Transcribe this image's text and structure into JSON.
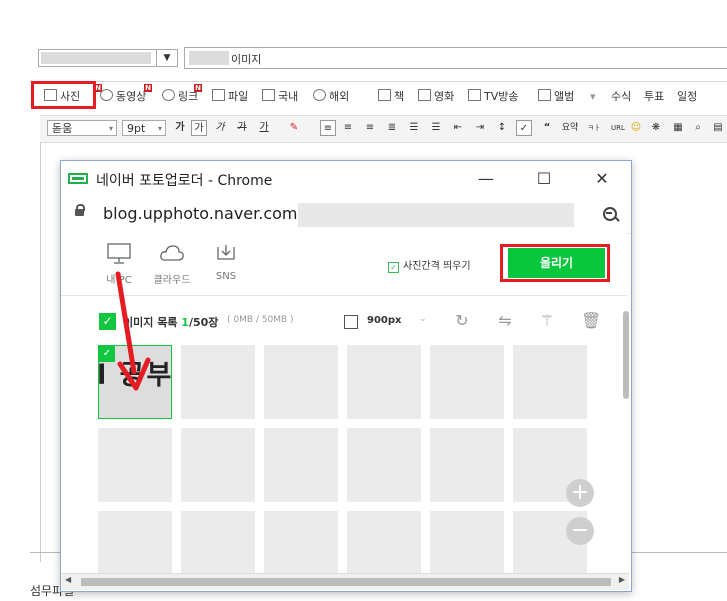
{
  "editor": {
    "title_suffix": "이미지",
    "toolbar1": [
      {
        "label": "사진",
        "badge": "N"
      },
      {
        "label": "동영상",
        "badge": "N"
      },
      {
        "label": "링크",
        "badge": "N"
      },
      {
        "label": "파일"
      },
      {
        "label": "국내"
      },
      {
        "label": "해외"
      },
      {
        "label": "책"
      },
      {
        "label": "영화"
      },
      {
        "label": "TV방송"
      },
      {
        "label": "앨범"
      },
      {
        "label": "수식"
      },
      {
        "label": "투표"
      },
      {
        "label": "일정"
      }
    ],
    "font_family": "돋움",
    "font_size": "9pt",
    "format_buttons": [
      "가",
      "가",
      "가",
      "가",
      "가"
    ],
    "quote_label": "요약",
    "url_label": "URL",
    "footer_text": "섬무파일"
  },
  "popup": {
    "window_title": "네이버 포토업로더 - Chrome",
    "address_text": "blog.upphoto.naver.com",
    "sources": [
      {
        "label": "내 PC",
        "icon": "monitor-icon"
      },
      {
        "label": "클라우드",
        "icon": "cloud-icon"
      },
      {
        "label": "SNS",
        "icon": "share-icon"
      }
    ],
    "spacing_checkbox_label": "사진간격 띄우기",
    "upload_button_label": "올리기",
    "list_title": "이미지 목록",
    "list_count": "1",
    "list_max": "/50장",
    "list_size": "( 0MB / 50MB )",
    "resize_value": "900px",
    "selected_thumb_text": "l 공부",
    "zoom_in": "+",
    "zoom_out": "−"
  },
  "colors": {
    "accent_green": "#08c73d",
    "highlight_red": "#e51c23",
    "badge_red": "#cc2222"
  }
}
